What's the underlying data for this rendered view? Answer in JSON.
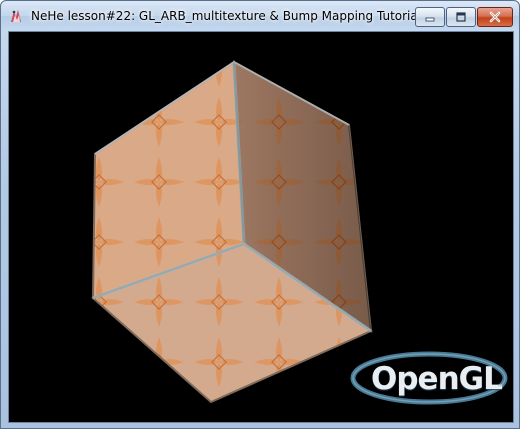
{
  "window": {
    "title": "NeHe lesson#22: GL_ARB_multitexture & Bump Mapping Tutorial",
    "icon": "nehe-app-icon",
    "buttons": {
      "minimize": "minimize-icon",
      "maximize": "maximize-icon",
      "close": "close-icon"
    }
  },
  "scene": {
    "background": "#000000",
    "object": "textured-cube",
    "logo": {
      "text": "OpenGL",
      "trademark": "™",
      "ring_color": "#4a7a93"
    }
  }
}
